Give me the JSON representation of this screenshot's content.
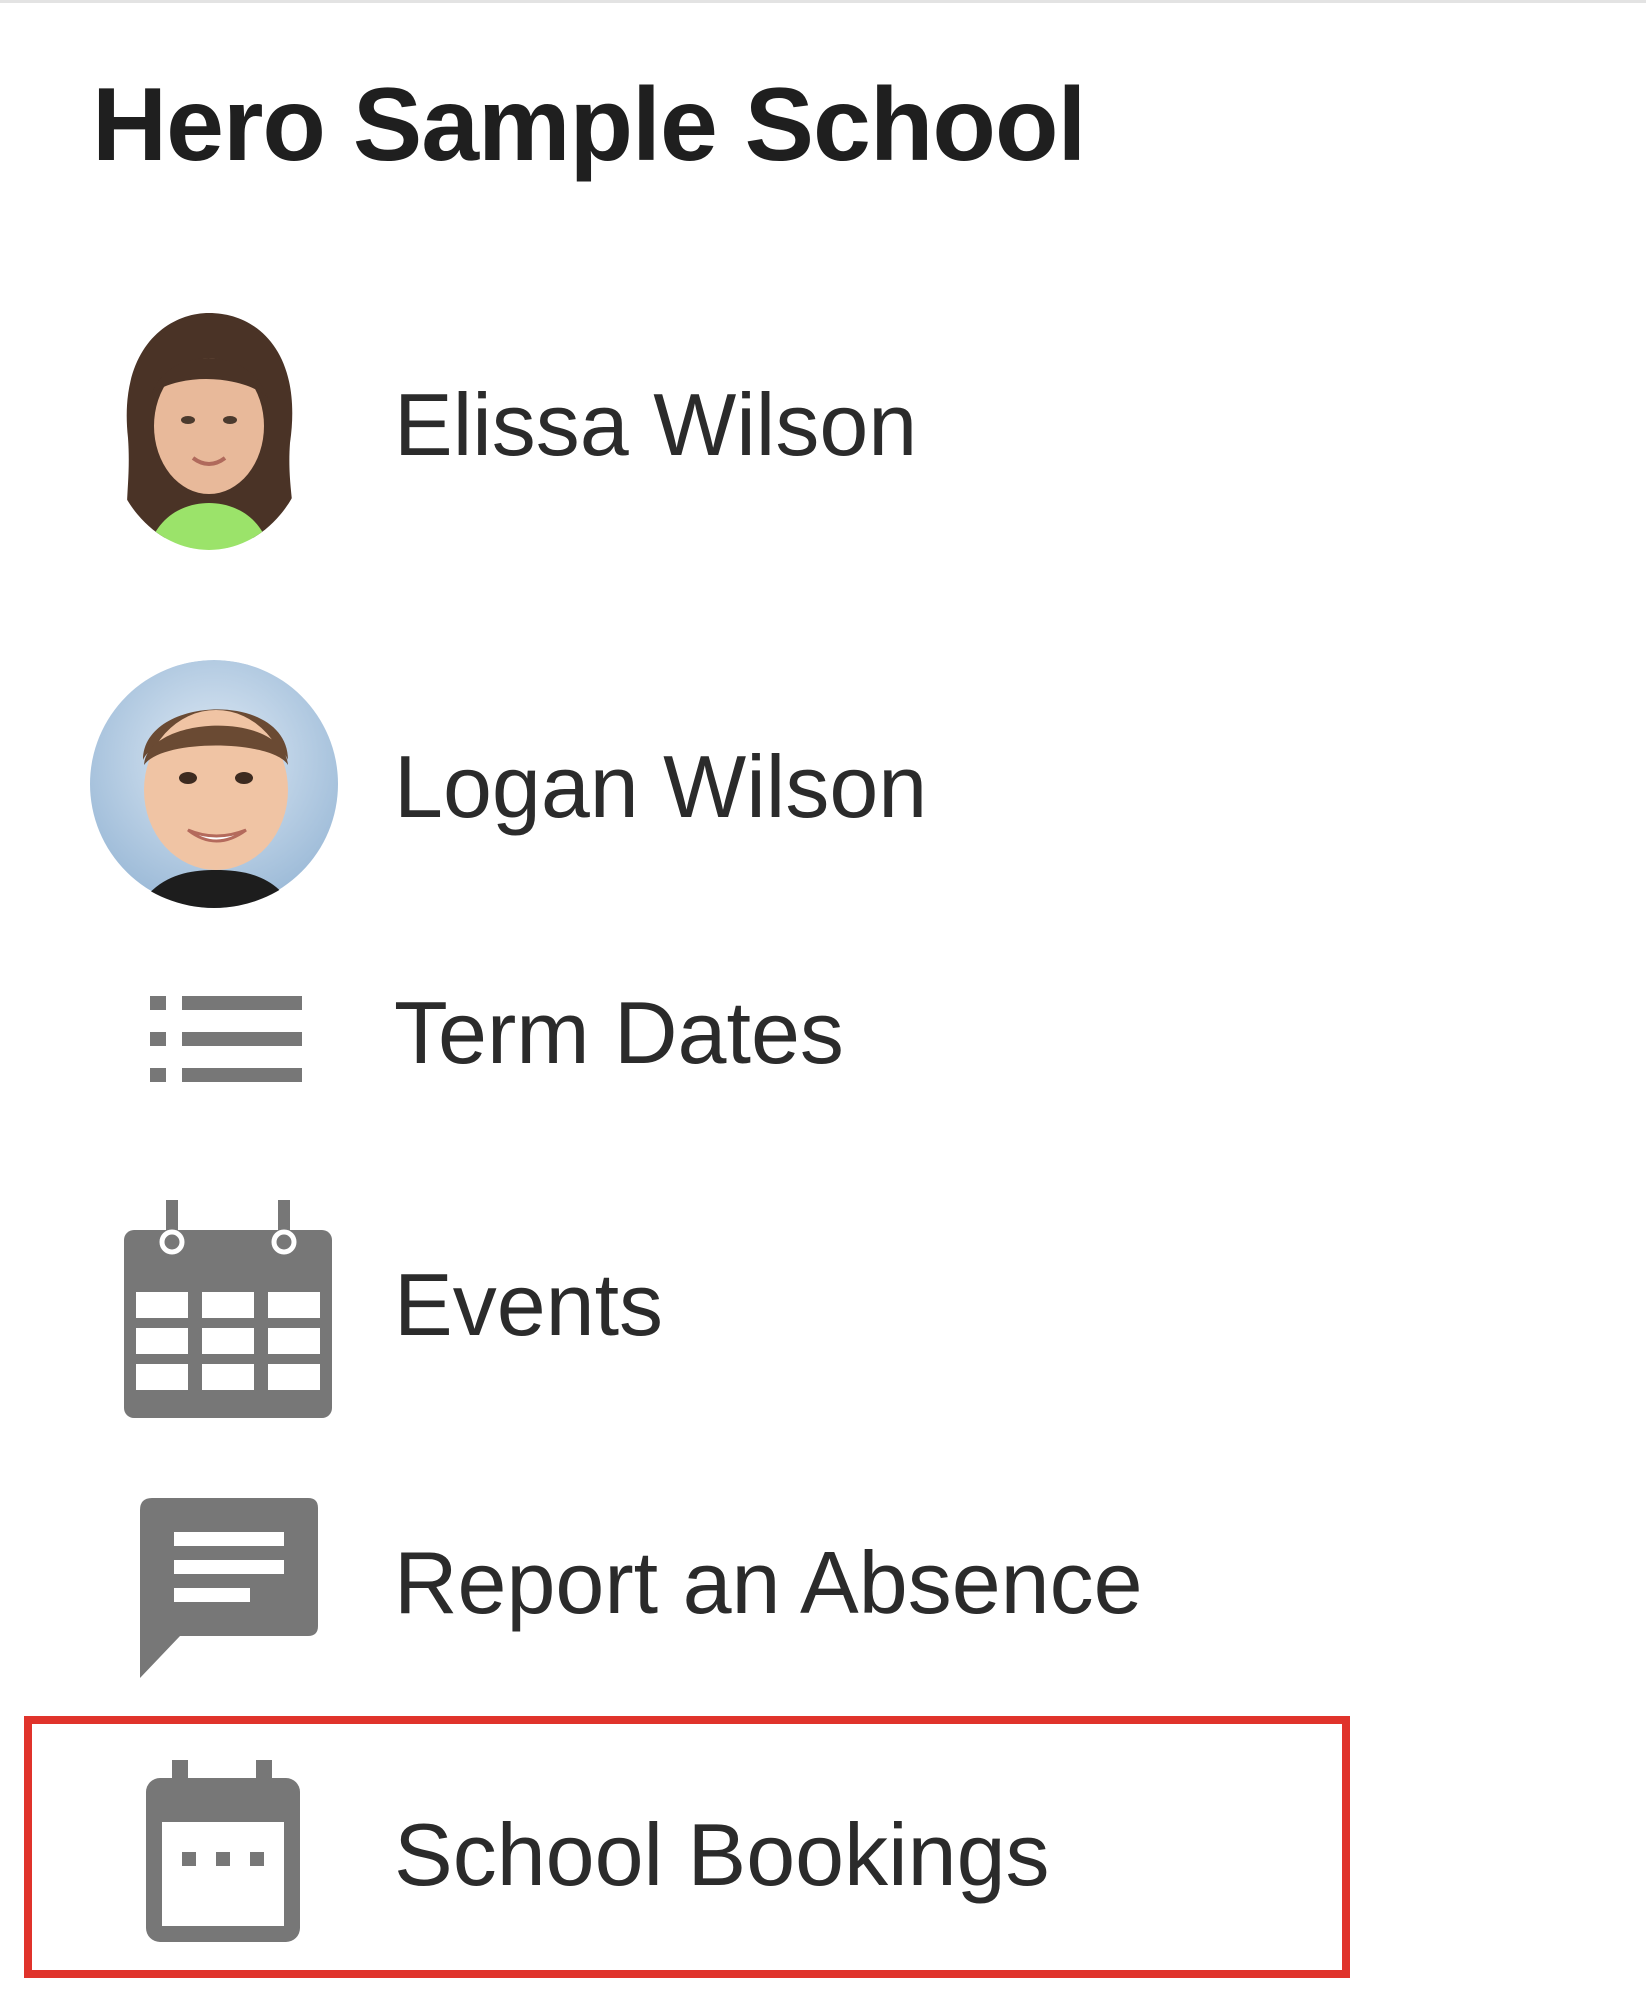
{
  "header": {
    "school_name": "Hero Sample School"
  },
  "menu": {
    "items": [
      {
        "label": "Elissa Wilson",
        "icon": "student-avatar-elissa"
      },
      {
        "label": "Logan Wilson",
        "icon": "student-avatar-logan"
      },
      {
        "label": "Term Dates",
        "icon": "list-icon"
      },
      {
        "label": "Events",
        "icon": "calendar-grid-icon"
      },
      {
        "label": "Report an Absence",
        "icon": "message-icon"
      },
      {
        "label": "School Bookings",
        "icon": "calendar-dots-icon"
      }
    ],
    "highlighted_item": "School Bookings"
  },
  "colors": {
    "icon_gray": "#777777",
    "highlight_red": "#e0332b",
    "text_dark": "#2b2b2b"
  }
}
